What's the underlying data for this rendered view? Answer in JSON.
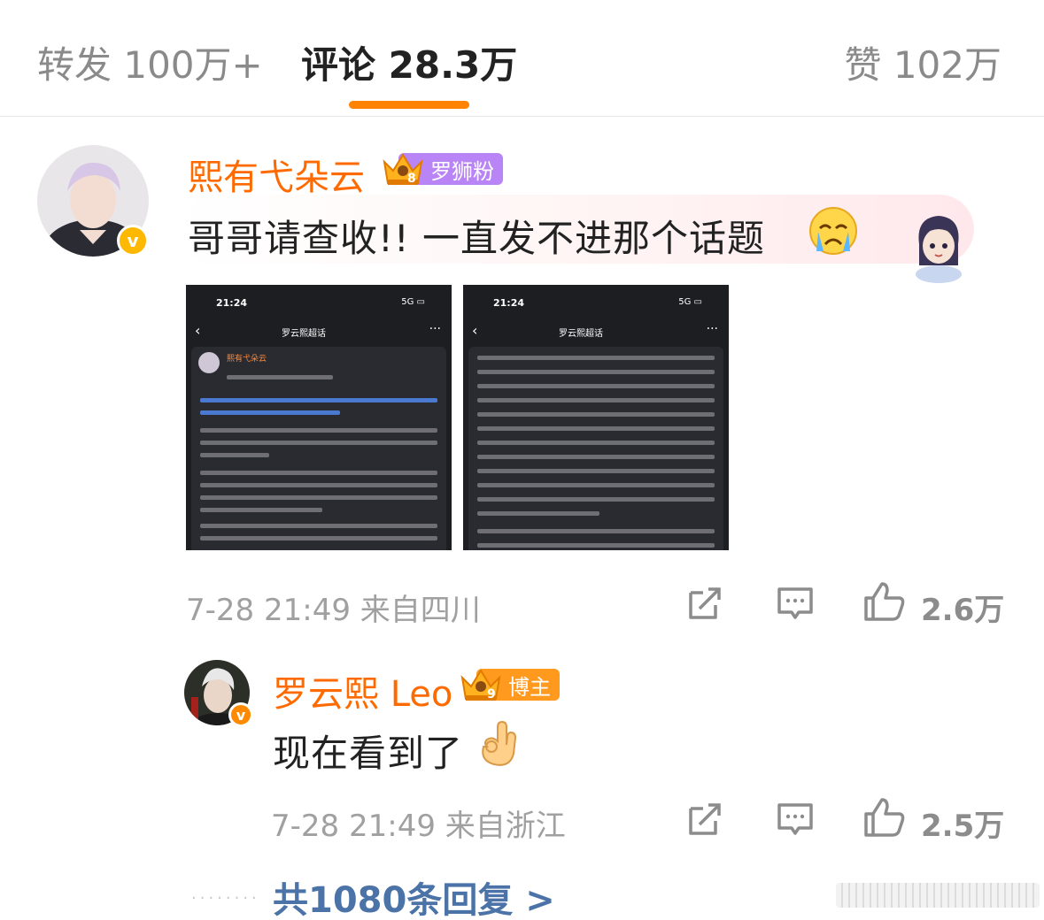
{
  "tabs": {
    "repost": "转发 100万+",
    "comments": "评论 28.3万",
    "likes": "赞 102万"
  },
  "comment": {
    "username": "熙有弋朵云",
    "badge_level": "8",
    "badge_label": "罗狮粉",
    "text": "哥哥请查收!!  一直发不进那个话题",
    "emoji": "crying-face",
    "meta": "7-28 21:49  来自四川",
    "like_count": "2.6万",
    "images": [
      {
        "time": "21:24",
        "nav_title": "罗云熙超话",
        "author": "熙有弋朵云"
      },
      {
        "time": "21:24",
        "nav_title": "罗云熙超话",
        "author": ""
      }
    ]
  },
  "reply": {
    "username": "罗云熙 Leo",
    "badge_level": "9",
    "badge_label": "博主",
    "text": "现在看到了",
    "emoji": "ok-hand",
    "meta": "7-28 21:49  来自浙江",
    "like_count": "2.5万"
  },
  "replies_link": "共1080条回复 >",
  "colors": {
    "accent": "#ff8200",
    "username": "#ff6a00",
    "link": "#4b73a7",
    "fan_badge": "#b984f5",
    "owner_badge": "#ff9a1f",
    "verified": "#ffb800"
  }
}
